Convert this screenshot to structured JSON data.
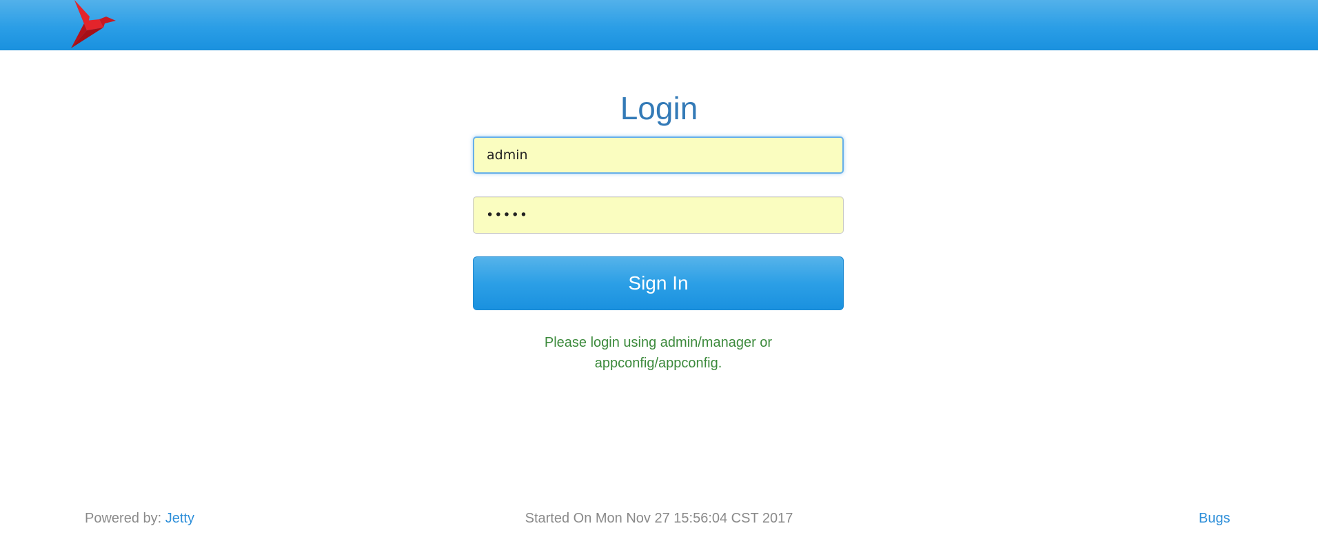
{
  "login": {
    "title": "Login",
    "username_value": "admin",
    "password_value": "•••••",
    "sign_in_label": "Sign In",
    "hint_line1": "Please login using admin/manager or",
    "hint_line2": "appconfig/appconfig."
  },
  "footer": {
    "powered_by_label": "Powered by:",
    "powered_by_link": "Jetty",
    "started_on": "Started On Mon Nov 27 15:56:04 CST 2017",
    "bugs_link": "Bugs"
  },
  "colors": {
    "header": "#2b9ee6",
    "title": "#337ab7",
    "input_bg": "#fafdc0",
    "hint": "#3c8a3c",
    "link": "#2e8fd9",
    "logo": "#d92027"
  },
  "icons": {
    "logo": "red-bird-logo"
  }
}
